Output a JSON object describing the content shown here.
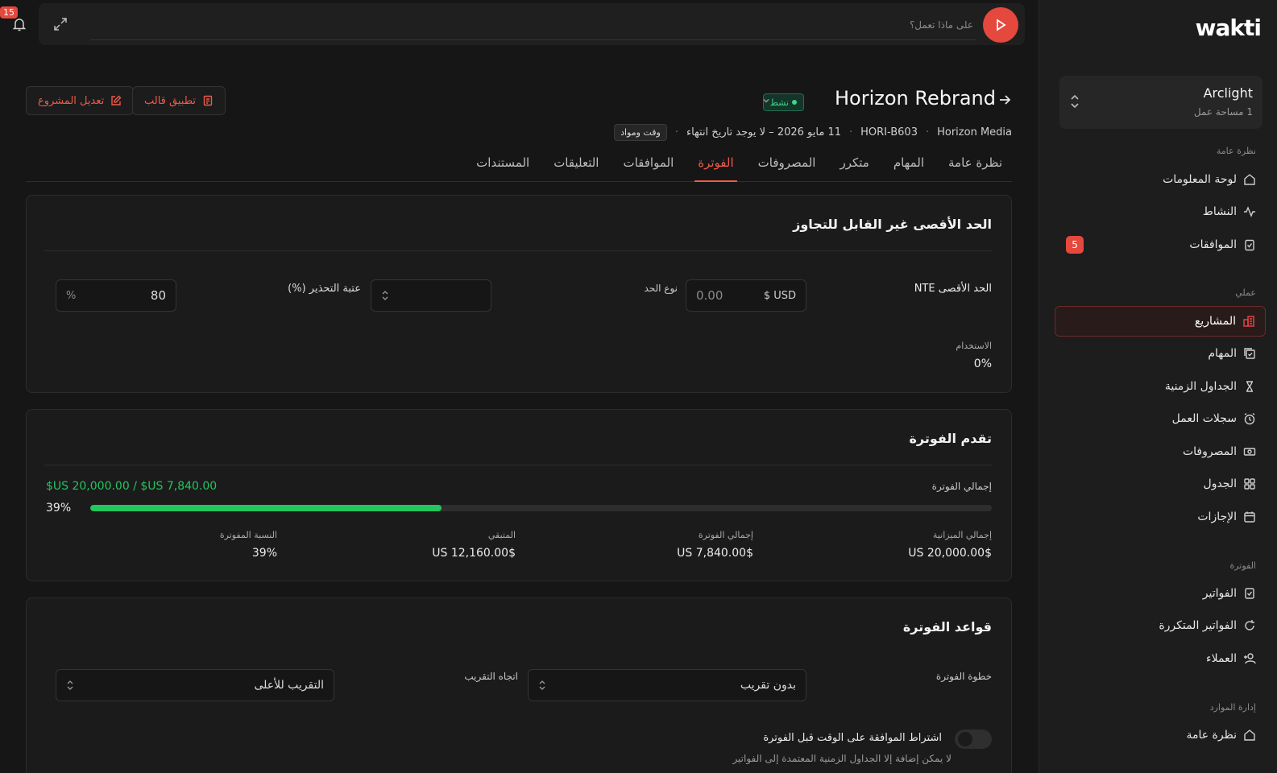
{
  "app": {
    "logo": "wakti",
    "notifications_count": "15"
  },
  "workspace": {
    "name": "Arclight",
    "sub": "1 مساحة عمل"
  },
  "sidebar": {
    "sections": [
      {
        "label": "نظرة عامة"
      },
      {
        "label": "عملي"
      },
      {
        "label": "الفوترة"
      },
      {
        "label": "إدارة الموارد"
      }
    ],
    "items": [
      {
        "label": "لوحة المعلومات",
        "icon": "home-icon"
      },
      {
        "label": "النشاط",
        "icon": "activity-icon"
      },
      {
        "label": "الموافقات",
        "icon": "clipboard-check-icon",
        "badge": "5"
      },
      {
        "label": "المشاريع",
        "icon": "projects-icon",
        "active": true
      },
      {
        "label": "المهام",
        "icon": "tasks-icon"
      },
      {
        "label": "الجداول الزمنية",
        "icon": "hourglass-icon"
      },
      {
        "label": "سجلات العمل",
        "icon": "alarm-icon"
      },
      {
        "label": "المصروفات",
        "icon": "money-icon"
      },
      {
        "label": "الجدول",
        "icon": "grid-icon"
      },
      {
        "label": "الإجازات",
        "icon": "calendar-icon"
      },
      {
        "label": "الفواتير",
        "icon": "invoice-icon"
      },
      {
        "label": "الفواتير المتكررة",
        "icon": "refresh-icon"
      },
      {
        "label": "العملاء",
        "icon": "user-plus-icon"
      },
      {
        "label": "نظرة عامة",
        "icon": "home-icon"
      }
    ]
  },
  "topbar": {
    "placeholder": "على ماذا تعمل؟"
  },
  "project": {
    "title": "Horizon Rebrand",
    "status": "نشط",
    "client": "Horizon Media",
    "code": "HORI-B603",
    "dates": "11 مايو 2026 – لا يوجد تاريخ انتهاء",
    "billing_type": "وقت ومواد",
    "btn_edit": "تعديل المشروع",
    "btn_template": "تطبيق قالب"
  },
  "tabs": [
    "نظرة عامة",
    "المهام",
    "متكرر",
    "المصروفات",
    "الفوترة",
    "الموافقات",
    "التعليقات",
    "المستندات"
  ],
  "active_tab": "الفوترة",
  "nte": {
    "title": "الحد الأقصى غير القابل للتجاوز",
    "max_label": "الحد الأقصى NTE",
    "currency": "USD $",
    "amount_placeholder": "0.00",
    "limit_type_label": "نوع الحد",
    "warning_label": "عتبة التحذير (%)",
    "warning_value": "80",
    "percent_sign": "%",
    "usage_label": "الاستخدام",
    "usage_value": "0%"
  },
  "progress": {
    "title": "تقدم الفوترة",
    "total_label": "إجمالي الفوترة",
    "summary": "$US 20,000.00 / $US 7,840.00",
    "percent": "39%",
    "fraction": 0.39,
    "stats": [
      {
        "label": "إجمالي الميزانية",
        "value": "$US 20,000.00"
      },
      {
        "label": "إجمالي الفوترة",
        "value": "$US 7,840.00"
      },
      {
        "label": "المتبقي",
        "value": "$US 12,160.00"
      },
      {
        "label": "النسبة المفوترة",
        "value": "39%"
      }
    ]
  },
  "rules": {
    "title": "قواعد الفوترة",
    "step_label": "خطوة الفوترة",
    "step_value": "بدون تقريب",
    "rounding_label": "اتجاه التقريب",
    "rounding_value": "التقريب للأعلى",
    "toggle_label": "اشتراط الموافقة على الوقت قبل الفوترة",
    "toggle_desc": "لا يمكن إضافة إلا الجداول الزمنية المعتمدة إلى الفواتير"
  }
}
